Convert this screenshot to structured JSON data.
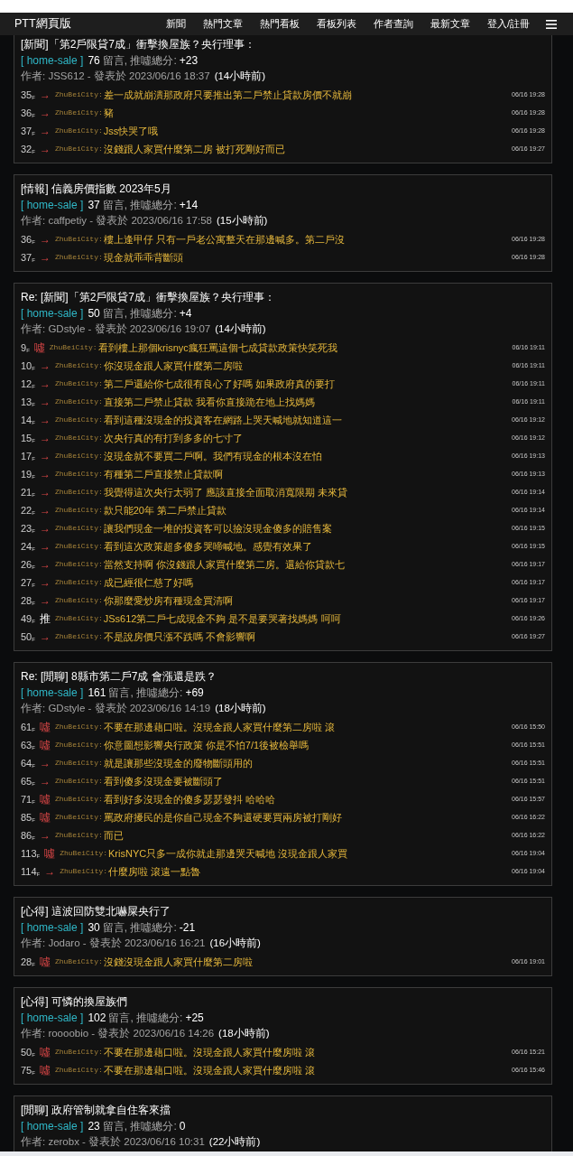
{
  "nav": {
    "brand": "PTT網頁版",
    "links": [
      "新聞",
      "熱門文章",
      "熱門看板",
      "看板列表",
      "作者查詢",
      "最新文章",
      "登入/註冊"
    ]
  },
  "posts": [
    {
      "title": "[新聞]「第2戶限貸7成」衝擊換屋族？央行理事：",
      "board": "[ home-sale ]",
      "count": "76",
      "stats_label": "留言, 推噓總分:",
      "score": "+23",
      "author_line": "作者: JSS612 - 發表於 2023/06/16 18:37",
      "ago": "(14小時前)",
      "comments": [
        {
          "floor": "35$_{F}$",
          "kind": "arrow",
          "tag": "→",
          "user": "ZhuBeiCity:",
          "text": "差一成就崩潰那政府只要推出第二戶禁止貸款房價不就崩",
          "time": "06/16 19:28"
        },
        {
          "floor": "36$_{F}$",
          "kind": "arrow",
          "tag": "→",
          "user": "ZhuBeiCity:",
          "text": "豬",
          "time": "06/16 19:28"
        },
        {
          "floor": "37$_{F}$",
          "kind": "arrow",
          "tag": "→",
          "user": "ZhuBeiCity:",
          "text": "Jss快哭了哦",
          "time": "06/16 19:28"
        },
        {
          "floor": "32$_{F}$",
          "kind": "arrow",
          "tag": "→",
          "user": "ZhuBeiCity:",
          "text": "沒錢跟人家買什麼第二房 被打死剛好而已",
          "time": "06/16 19:27"
        }
      ]
    },
    {
      "title": "[情報] 信義房價指數 2023年5月",
      "board": "[ home-sale ]",
      "count": "37",
      "stats_label": "留言, 推噓總分:",
      "score": "+14",
      "author_line": "作者: caffpetiy - 發表於 2023/06/16 17:58",
      "ago": "(15小時前)",
      "comments": [
        {
          "floor": "36$_{F}$",
          "kind": "arrow",
          "tag": "→",
          "user": "ZhuBeiCity:",
          "text": "樓上逢甲仔 只有一戶老公寓整天在那邊喊多。第二戶沒",
          "time": "06/16 19:28"
        },
        {
          "floor": "37$_{F}$",
          "kind": "arrow",
          "tag": "→",
          "user": "ZhuBeiCity:",
          "text": "現金就乖乖背斷頭",
          "time": "06/16 19:28"
        }
      ]
    },
    {
      "title": "Re: [新聞]「第2戶限貸7成」衝擊換屋族？央行理事：",
      "board": "[ home-sale ]",
      "count": "50",
      "stats_label": "留言, 推噓總分:",
      "score": "+4",
      "author_line": "作者: GDstyle - 發表於 2023/06/16 19:07",
      "ago": "(14小時前)",
      "comments": [
        {
          "floor": "9$_{F}$",
          "kind": "boo",
          "tag": "噓",
          "user": "ZhuBeiCity:",
          "text": "看到樓上那個krisnyc瘋狂罵這個七成貸款政策快笑死我",
          "time": "06/16 19:11"
        },
        {
          "floor": "10$_{F}$",
          "kind": "arrow",
          "tag": "→",
          "user": "ZhuBeiCity:",
          "text": "你沒現金跟人家買什麼第二房啦",
          "time": "06/16 19:11"
        },
        {
          "floor": "12$_{F}$",
          "kind": "arrow",
          "tag": "→",
          "user": "ZhuBeiCity:",
          "text": "第二戶還給你七成很有良心了好嗎 如果政府真的要打",
          "time": "06/16 19:11"
        },
        {
          "floor": "13$_{F}$",
          "kind": "arrow",
          "tag": "→",
          "user": "ZhuBeiCity:",
          "text": "直接第二戶禁止貸款 我看你直接跪在地上找媽媽",
          "time": "06/16 19:11"
        },
        {
          "floor": "14$_{F}$",
          "kind": "arrow",
          "tag": "→",
          "user": "ZhuBeiCity:",
          "text": "看到這種沒現金的投資客在網路上哭天喊地就知道這一",
          "time": "06/16 19:12"
        },
        {
          "floor": "15$_{F}$",
          "kind": "arrow",
          "tag": "→",
          "user": "ZhuBeiCity:",
          "text": "次央行真的有打到多多的七寸了",
          "time": "06/16 19:12"
        },
        {
          "floor": "17$_{F}$",
          "kind": "arrow",
          "tag": "→",
          "user": "ZhuBeiCity:",
          "text": "沒現金就不要買二戶啊。我們有現金的根本沒在怕",
          "time": "06/16 19:13"
        },
        {
          "floor": "19$_{F}$",
          "kind": "arrow",
          "tag": "→",
          "user": "ZhuBeiCity:",
          "text": "有種第二戶直接禁止貸款啊",
          "time": "06/16 19:13"
        },
        {
          "floor": "21$_{F}$",
          "kind": "arrow",
          "tag": "→",
          "user": "ZhuBeiCity:",
          "text": "我覺得這次央行太弱了 應該直接全面取消寬限期 未來貸",
          "time": "06/16 19:14"
        },
        {
          "floor": "22$_{F}$",
          "kind": "arrow",
          "tag": "→",
          "user": "ZhuBeiCity:",
          "text": "款只能20年 第二戶禁止貸款",
          "time": "06/16 19:14"
        },
        {
          "floor": "23$_{F}$",
          "kind": "arrow",
          "tag": "→",
          "user": "ZhuBeiCity:",
          "text": "讓我們現金一堆的投資客可以撿沒現金傻多的賠售案",
          "time": "06/16 19:15"
        },
        {
          "floor": "24$_{F}$",
          "kind": "arrow",
          "tag": "→",
          "user": "ZhuBeiCity:",
          "text": "看到這次政策超多傻多哭啼喊地。感覺有效果了",
          "time": "06/16 19:15"
        },
        {
          "floor": "26$_{F}$",
          "kind": "arrow",
          "tag": "→",
          "user": "ZhuBeiCity:",
          "text": "當然支持啊 你沒錢跟人家買什麼第二房。還給你貸款七",
          "time": "06/16 19:17"
        },
        {
          "floor": "27$_{F}$",
          "kind": "arrow",
          "tag": "→",
          "user": "ZhuBeiCity:",
          "text": "成已經很仁慈了好嗎",
          "time": "06/16 19:17"
        },
        {
          "floor": "28$_{F}$",
          "kind": "arrow",
          "tag": "→",
          "user": "ZhuBeiCity:",
          "text": "你那麼愛炒房有種現金買清啊",
          "time": "06/16 19:17"
        },
        {
          "floor": "49$_{F}$",
          "kind": "push",
          "tag": "推",
          "user": "ZhuBeiCity:",
          "text": "JSs612第二戶七成現金不夠 是不是要哭著找媽媽 呵呵",
          "time": "06/16 19:26"
        },
        {
          "floor": "50$_{F}$",
          "kind": "arrow",
          "tag": "→",
          "user": "ZhuBeiCity:",
          "text": "不是說房價只漲不跌嗎 不會影響啊",
          "time": "06/16 19:27"
        }
      ]
    },
    {
      "title": "Re: [閒聊] 8縣市第二戶7成 會漲還是跌？",
      "board": "[ home-sale ]",
      "count": "161",
      "stats_label": "留言, 推噓總分:",
      "score": "+69",
      "author_line": "作者: GDstyle - 發表於 2023/06/16 14:19",
      "ago": "(18小時前)",
      "comments": [
        {
          "floor": "61$_{F}$",
          "kind": "boo",
          "tag": "噓",
          "user": "ZhuBeiCity:",
          "text": "不要在那邊藉口啦。沒現金跟人家買什麼第二房啦 滾",
          "time": "06/16 15:50"
        },
        {
          "floor": "63$_{F}$",
          "kind": "boo",
          "tag": "噓",
          "user": "ZhuBeiCity:",
          "text": "你意圖想影響央行政策 你是不怕7/1後被檢舉嗎",
          "time": "06/16 15:51"
        },
        {
          "floor": "64$_{F}$",
          "kind": "arrow",
          "tag": "→",
          "user": "ZhuBeiCity:",
          "text": "就是讓那些沒現金的廢物斷頭用的",
          "time": "06/16 15:51"
        },
        {
          "floor": "65$_{F}$",
          "kind": "arrow",
          "tag": "→",
          "user": "ZhuBeiCity:",
          "text": "看到傻多沒現金要被斷頭了",
          "time": "06/16 15:51"
        },
        {
          "floor": "71$_{F}$",
          "kind": "boo",
          "tag": "噓",
          "user": "ZhuBeiCity:",
          "text": "看到好多沒現金的傻多瑟瑟發抖 哈哈哈",
          "time": "06/16 15:57"
        },
        {
          "floor": "85$_{F}$",
          "kind": "boo",
          "tag": "噓",
          "user": "ZhuBeiCity:",
          "text": "罵政府擾民的是你自己現金不夠還硬要買兩房被打剛好",
          "time": "06/16 16:22"
        },
        {
          "floor": "86$_{F}$",
          "kind": "arrow",
          "tag": "→",
          "user": "ZhuBeiCity:",
          "text": "而已",
          "time": "06/16 16:22"
        },
        {
          "floor": "113$_{F}$",
          "kind": "boo",
          "tag": "噓",
          "user": "ZhuBeiCity:",
          "text": "KrisNYC只多一成你就走那邊哭天喊地 沒現金跟人家買",
          "time": "06/16 19:04"
        },
        {
          "floor": "114$_{F}$",
          "kind": "arrow",
          "tag": "→",
          "user": "ZhuBeiCity:",
          "text": "什麼房啦 滾遠一點魯",
          "time": "06/16 19:04"
        }
      ]
    },
    {
      "title": "[心得] 這波回防雙北嚇屎央行了",
      "board": "[ home-sale ]",
      "count": "30",
      "stats_label": "留言, 推噓總分:",
      "score": "-21",
      "author_line": "作者: Jodaro - 發表於 2023/06/16 16:21",
      "ago": "(16小時前)",
      "comments": [
        {
          "floor": "28$_{F}$",
          "kind": "boo",
          "tag": "噓",
          "user": "ZhuBeiCity:",
          "text": "沒錢沒現金跟人家買什麼第二房啦",
          "time": "06/16 19:01"
        }
      ]
    },
    {
      "title": "[心得] 可憐的換屋族們",
      "board": "[ home-sale ]",
      "count": "102",
      "stats_label": "留言, 推噓總分:",
      "score": "+25",
      "author_line": "作者: roooobio - 發表於 2023/06/16 14:26",
      "ago": "(18小時前)",
      "comments": [
        {
          "floor": "50$_{F}$",
          "kind": "boo",
          "tag": "噓",
          "user": "ZhuBeiCity:",
          "text": "不要在那邊藉口啦。沒現金跟人家買什麼房啦 滾",
          "time": "06/16 15:21"
        },
        {
          "floor": "75$_{F}$",
          "kind": "boo",
          "tag": "噓",
          "user": "ZhuBeiCity:",
          "text": "不要在那邊藉口啦。沒現金跟人家買什麼房啦 滾",
          "time": "06/16 15:46"
        }
      ]
    },
    {
      "title": "[閒聊] 政府管制就拿自住客來擋",
      "board": "[ home-sale ]",
      "count": "23",
      "stats_label": "留言, 推噓總分:",
      "score": "0",
      "author_line": "作者: zerobx - 發表於 2023/06/16 10:31",
      "ago": "(22小時前)"
    }
  ]
}
